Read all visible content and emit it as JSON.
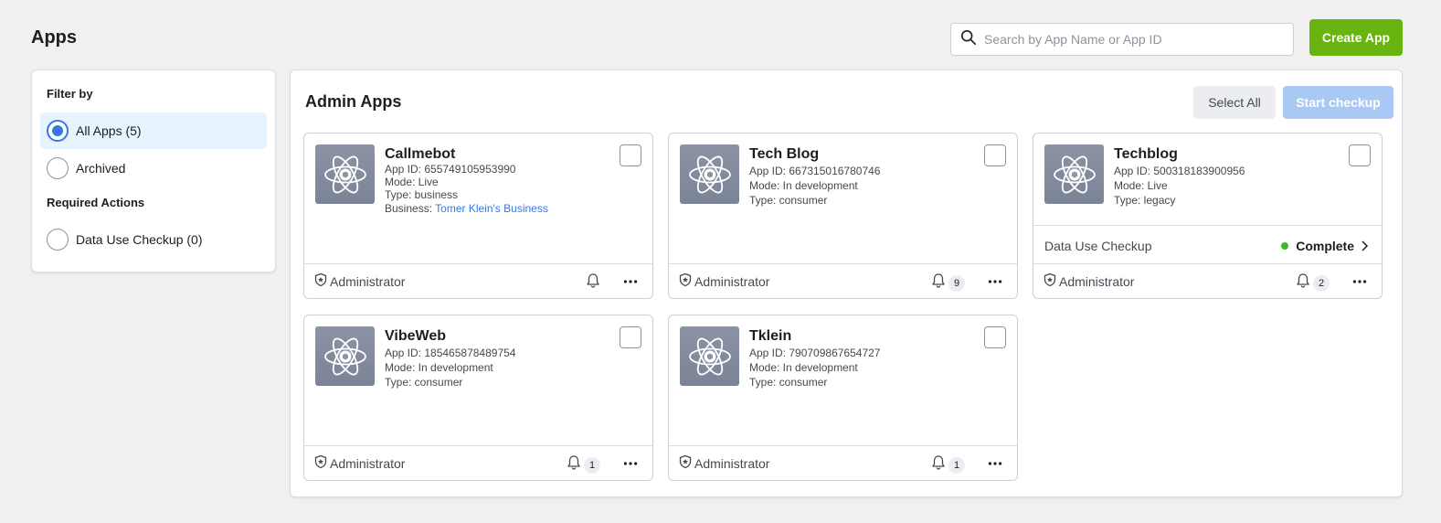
{
  "header": {
    "title": "Apps",
    "search_placeholder": "Search by App Name or App ID",
    "create_label": "Create App"
  },
  "sidebar": {
    "filter_heading": "Filter by",
    "filters": [
      {
        "label": "All Apps (5)",
        "selected": true
      },
      {
        "label": "Archived",
        "selected": false
      }
    ],
    "required_heading": "Required Actions",
    "required": [
      {
        "label": "Data Use Checkup (0)",
        "selected": false
      }
    ]
  },
  "main": {
    "title": "Admin Apps",
    "select_all_label": "Select All",
    "start_checkup_label": "Start checkup",
    "apps": [
      {
        "name": "Callmebot",
        "app_id": "App ID: 655749105953990",
        "mode": "Mode: Live",
        "type": "Type: business",
        "business_prefix": "Business: ",
        "business_link": "Tomer Klein's Business",
        "role": "Administrator",
        "notifications": ""
      },
      {
        "name": "Tech Blog",
        "app_id": "App ID: 667315016780746",
        "mode": "Mode: In development",
        "type": "Type: consumer",
        "role": "Administrator",
        "notifications": "9"
      },
      {
        "name": "Techblog",
        "app_id": "App ID: 500318183900956",
        "mode": "Mode: Live",
        "type": "Type: legacy",
        "checkup_label": "Data Use Checkup",
        "checkup_status": "Complete",
        "role": "Administrator",
        "notifications": "2"
      },
      {
        "name": "VibeWeb",
        "app_id": "App ID: 185465878489754",
        "mode": "Mode: In development",
        "type": "Type: consumer",
        "role": "Administrator",
        "notifications": "1"
      },
      {
        "name": "Tklein",
        "app_id": "App ID: 790709867654727",
        "mode": "Mode: In development",
        "type": "Type: consumer",
        "role": "Administrator",
        "notifications": "1"
      }
    ]
  },
  "colors": {
    "accent": "#3578e5",
    "create_button": "#69b40f",
    "status_complete": "#42b72a"
  },
  "icons": [
    "search-icon",
    "app-atom-icon",
    "admin-shield-icon",
    "bell-icon",
    "more-icon",
    "chevron-right-icon"
  ]
}
